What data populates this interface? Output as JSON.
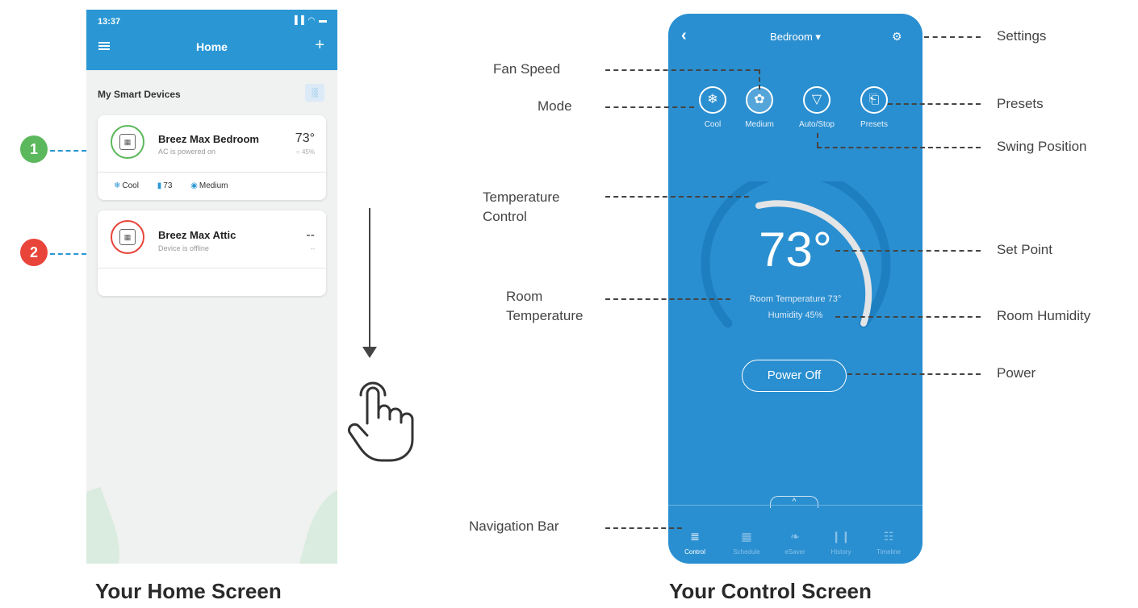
{
  "home": {
    "status_time": "13:37",
    "status_icons": "▐▐ ◠ ▬",
    "title": "Home",
    "add_label": "+",
    "section_title": "My Smart Devices",
    "chart_icon": "bar-chart-icon",
    "devices": [
      {
        "marker": "1",
        "name": "Breez Max Bedroom",
        "status": "AC is powered on",
        "temp": "73°",
        "humidity": "○ 45%",
        "mode": "Cool",
        "setpoint": "73",
        "fan": "Medium",
        "ring_color": "#5cb85c"
      },
      {
        "marker": "2",
        "name": "Breez Max Attic",
        "status": "Device is offline",
        "temp": "--",
        "humidity": "--",
        "ring_color": "#e8443a"
      }
    ]
  },
  "control": {
    "room": "Bedroom ▾",
    "back_icon": "chevron-left-icon",
    "settings_icon": "gear-icon",
    "modes": [
      {
        "icon": "❄",
        "label": "Cool"
      },
      {
        "icon": "✿",
        "label": "Medium"
      },
      {
        "icon": "▽",
        "label": "Auto/Stop"
      },
      {
        "icon": "⎗",
        "label": "Presets"
      }
    ],
    "set_point": "73°",
    "room_temperature": "Room Temperature 73°",
    "humidity": "Humidity 45%",
    "power_label": "Power Off",
    "expand_icon": "^",
    "nav": [
      {
        "glyph": "≣",
        "label": "Control",
        "active": true
      },
      {
        "glyph": "▦",
        "label": "Schedule",
        "active": false
      },
      {
        "glyph": "❧",
        "label": "eSaver",
        "active": false
      },
      {
        "glyph": "❙❙",
        "label": "History",
        "active": false
      },
      {
        "glyph": "☷",
        "label": "Timeline",
        "active": false
      }
    ]
  },
  "callouts": {
    "fan_speed": "Fan Speed",
    "mode": "Mode",
    "temperature_control_1": "Temperature",
    "temperature_control_2": "Control",
    "room_temperature_1": "Room",
    "room_temperature_2": "Temperature",
    "navigation_bar": "Navigation Bar",
    "settings": "Settings",
    "presets": "Presets",
    "swing_position": "Swing Position",
    "set_point": "Set Point",
    "room_humidity": "Room Humidity",
    "power": "Power"
  },
  "captions": {
    "home": "Your Home Screen",
    "control": "Your Control Screen"
  },
  "colors": {
    "brand_blue": "#2a97d4",
    "marker_green": "#5cb85c",
    "marker_red": "#e8443a"
  }
}
